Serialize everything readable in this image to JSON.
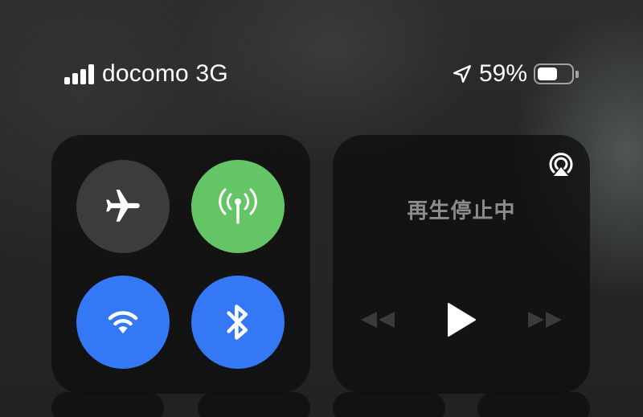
{
  "status_bar": {
    "carrier": "docomo 3G",
    "signal_bars_filled": 4,
    "signal_bars_total": 4,
    "location_icon": "location-arrow-icon",
    "battery_percent_text": "59%",
    "battery_level": 0.59
  },
  "connectivity": {
    "airplane_mode": {
      "icon": "airplane-icon",
      "state": "off",
      "color": "#3c3c3e"
    },
    "cellular_data": {
      "icon": "cellular-antenna-icon",
      "state": "on",
      "color": "#65c466"
    },
    "wifi": {
      "icon": "wifi-icon",
      "state": "on",
      "color": "#3478f6"
    },
    "bluetooth": {
      "icon": "bluetooth-icon",
      "state": "on",
      "color": "#3478f6"
    }
  },
  "media": {
    "status_text": "再生停止中",
    "airplay_icon": "airplay-audio-icon",
    "rewind_icon": "rewind-icon",
    "play_icon": "play-icon",
    "fast_forward_icon": "fast-forward-icon"
  },
  "colors": {
    "tile_background": "#0e0e0e",
    "toggle_off": "#3c3c3e",
    "toggle_green": "#65c466",
    "toggle_blue": "#3478f6",
    "muted_text": "#8c8c8c"
  }
}
